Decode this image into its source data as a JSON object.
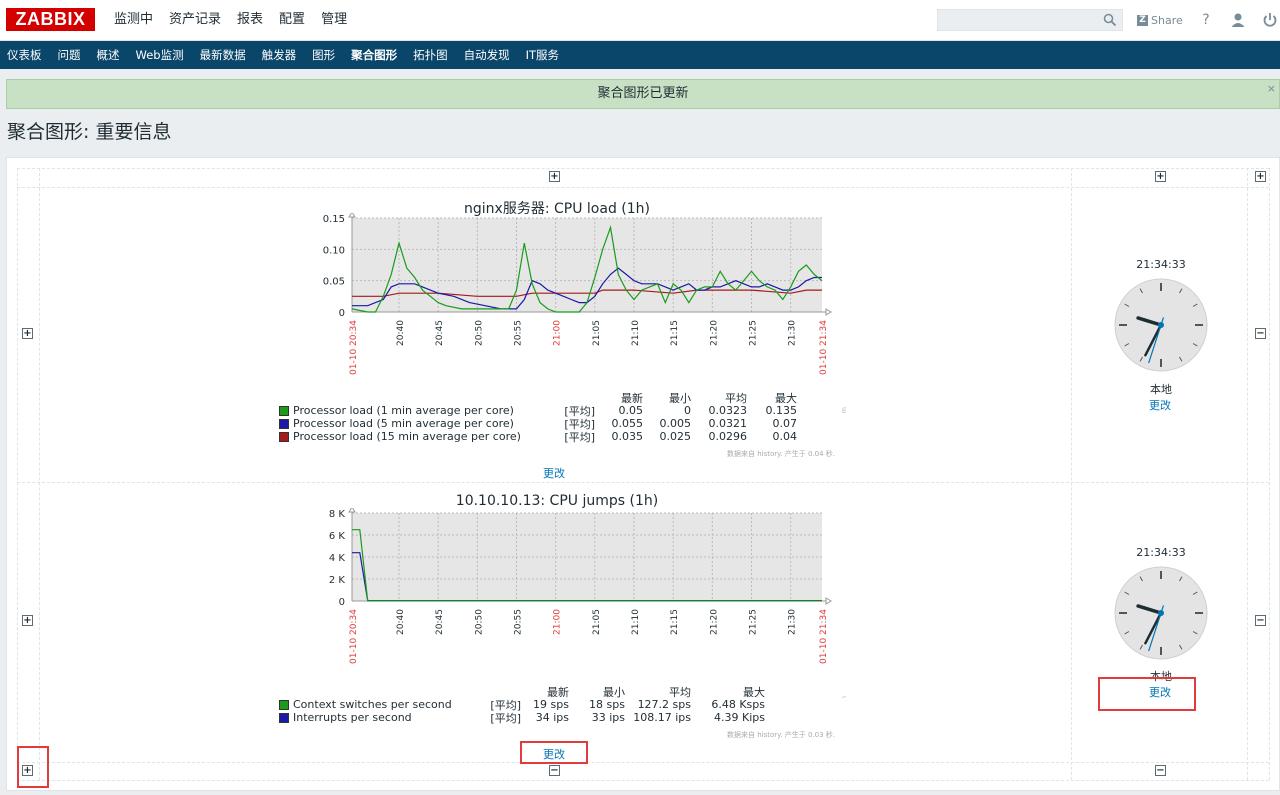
{
  "header": {
    "logo": "ZABBIX",
    "menu": [
      "监测中",
      "资产记录",
      "报表",
      "配置",
      "管理"
    ],
    "search": {
      "placeholder": "",
      "value": ""
    },
    "share_label": "Share",
    "help_label": "?"
  },
  "subnav": {
    "items": [
      "仪表板",
      "问题",
      "概述",
      "Web监测",
      "最新数据",
      "触发器",
      "图形",
      "聚合图形",
      "拓扑图",
      "自动发现",
      "IT服务"
    ],
    "active": "聚合图形"
  },
  "message": {
    "text": "聚合图形已更新",
    "close": "×"
  },
  "page": {
    "title": "聚合图形: 重要信息"
  },
  "controls": {
    "plus": "+",
    "minus": "−"
  },
  "graph1": {
    "title": "nginx服务器: CPU load (1h)",
    "y_ticks": [
      "0.15",
      "0.10",
      "0.05",
      "0"
    ],
    "x_ticks": [
      "20:40",
      "20:45",
      "20:50",
      "20:55",
      "21:00",
      "21:05",
      "21:10",
      "21:15",
      "21:20",
      "21:25",
      "21:30"
    ],
    "x_start": "01-10 20:34",
    "x_end": "01-10 21:34",
    "watermark": "http://www.zabbix.com",
    "legend_headers": [
      "最新",
      "最小",
      "平均",
      "最大"
    ],
    "legend": [
      {
        "name": "Processor load (1 min average per core)",
        "func": "[平均]",
        "last": "0.05",
        "min": "0",
        "avg": "0.0323",
        "max": "0.135",
        "color": "#1a9b1a"
      },
      {
        "name": "Processor load (5 min average per core)",
        "func": "[平均]",
        "last": "0.055",
        "min": "0.005",
        "avg": "0.0321",
        "max": "0.07",
        "color": "#1a1aa6"
      },
      {
        "name": "Processor load (15 min average per core)",
        "func": "[平均]",
        "last": "0.035",
        "min": "0.025",
        "avg": "0.0296",
        "max": "0.04",
        "color": "#a61a1a"
      }
    ],
    "footnote": "数据来自 history. 产生于 0.04 秒.",
    "edit_label": "更改"
  },
  "graph2": {
    "title": "10.10.10.13: CPU jumps (1h)",
    "y_ticks": [
      "8 K",
      "6 K",
      "4 K",
      "2 K",
      "0"
    ],
    "x_ticks": [
      "20:40",
      "20:45",
      "20:50",
      "20:55",
      "21:00",
      "21:05",
      "21:10",
      "21:15",
      "21:20",
      "21:25",
      "21:30"
    ],
    "x_start": "01-10 20:34",
    "x_end": "01-10 21:34",
    "watermark": "http://www.zabbix.com",
    "legend_headers": [
      "最新",
      "最小",
      "平均",
      "最大"
    ],
    "legend": [
      {
        "name": "Context switches per second",
        "func": "[平均]",
        "last": "19 sps",
        "min": "18 sps",
        "avg": "127.2 sps",
        "max": "6.48 Ksps",
        "color": "#1a9b1a"
      },
      {
        "name": "Interrupts per second",
        "func": "[平均]",
        "last": "34 ips",
        "min": "33 ips",
        "avg": "108.17 ips",
        "max": "4.39 Kips",
        "color": "#1a1aa6"
      }
    ],
    "footnote": "数据来自 history. 产生于 0.03 秒.",
    "edit_label": "更改"
  },
  "clock1": {
    "time": "21:34:33",
    "label": "本地",
    "edit_label": "更改"
  },
  "clock2": {
    "time": "21:34:33",
    "label": "本地",
    "edit_label": "更改"
  },
  "chart_data": [
    {
      "type": "line",
      "title": "nginx服务器: CPU load (1h)",
      "x_range": [
        "01-10 20:34",
        "01-10 21:34"
      ],
      "ylim": [
        0,
        0.15
      ],
      "grid": true,
      "series": [
        {
          "name": "Processor load (1 min average per core)",
          "color": "#1a9b1a",
          "x": [
            "20:34",
            "20:36",
            "20:37",
            "20:38",
            "20:39",
            "20:40",
            "20:41",
            "20:42",
            "20:43",
            "20:44",
            "20:45",
            "20:46",
            "20:48",
            "20:50",
            "20:52",
            "20:54",
            "20:55",
            "20:56",
            "20:57",
            "20:58",
            "20:59",
            "21:00",
            "21:01",
            "21:02",
            "21:03",
            "21:04",
            "21:05",
            "21:06",
            "21:07",
            "21:08",
            "21:09",
            "21:10",
            "21:11",
            "21:12",
            "21:13",
            "21:14",
            "21:15",
            "21:16",
            "21:17",
            "21:18",
            "21:19",
            "21:20",
            "21:21",
            "21:22",
            "21:23",
            "21:24",
            "21:25",
            "21:26",
            "21:27",
            "21:28",
            "21:29",
            "21:30",
            "21:31",
            "21:32",
            "21:33",
            "21:34"
          ],
          "y": [
            0.005,
            0.0,
            0.0,
            0.025,
            0.06,
            0.11,
            0.07,
            0.055,
            0.035,
            0.025,
            0.015,
            0.01,
            0.005,
            0.005,
            0.005,
            0.005,
            0.035,
            0.11,
            0.045,
            0.015,
            0.005,
            0.0,
            0.0,
            0.0,
            0.0,
            0.015,
            0.055,
            0.1,
            0.135,
            0.06,
            0.035,
            0.02,
            0.035,
            0.04,
            0.045,
            0.015,
            0.045,
            0.035,
            0.015,
            0.035,
            0.04,
            0.04,
            0.065,
            0.045,
            0.035,
            0.05,
            0.065,
            0.05,
            0.04,
            0.035,
            0.02,
            0.04,
            0.065,
            0.075,
            0.06,
            0.05
          ]
        },
        {
          "name": "Processor load (5 min average per core)",
          "color": "#1a1aa6",
          "x": [
            "20:34",
            "20:36",
            "20:37",
            "20:38",
            "20:39",
            "20:40",
            "20:41",
            "20:42",
            "20:43",
            "20:44",
            "20:45",
            "20:47",
            "20:49",
            "20:51",
            "20:53",
            "20:55",
            "20:56",
            "20:57",
            "20:58",
            "20:59",
            "21:00",
            "21:01",
            "21:02",
            "21:03",
            "21:04",
            "21:05",
            "21:06",
            "21:07",
            "21:08",
            "21:09",
            "21:10",
            "21:11",
            "21:12",
            "21:13",
            "21:14",
            "21:15",
            "21:16",
            "21:17",
            "21:18",
            "21:19",
            "21:20",
            "21:21",
            "21:22",
            "21:23",
            "21:24",
            "21:25",
            "21:26",
            "21:27",
            "21:28",
            "21:29",
            "21:30",
            "21:31",
            "21:32",
            "21:33",
            "21:34"
          ],
          "y": [
            0.01,
            0.01,
            0.015,
            0.02,
            0.04,
            0.045,
            0.045,
            0.045,
            0.04,
            0.035,
            0.03,
            0.025,
            0.015,
            0.01,
            0.005,
            0.005,
            0.02,
            0.05,
            0.045,
            0.035,
            0.03,
            0.025,
            0.02,
            0.015,
            0.015,
            0.025,
            0.045,
            0.06,
            0.07,
            0.06,
            0.05,
            0.045,
            0.045,
            0.045,
            0.04,
            0.035,
            0.04,
            0.045,
            0.035,
            0.035,
            0.04,
            0.04,
            0.045,
            0.05,
            0.045,
            0.04,
            0.04,
            0.045,
            0.04,
            0.035,
            0.035,
            0.04,
            0.05,
            0.055,
            0.055
          ]
        },
        {
          "name": "Processor load (15 min average per core)",
          "color": "#a61a1a",
          "x": [
            "20:34",
            "20:38",
            "20:40",
            "20:45",
            "20:50",
            "20:55",
            "20:57",
            "21:00",
            "21:05",
            "21:06",
            "21:10",
            "21:15",
            "21:18",
            "21:20",
            "21:25",
            "21:30",
            "21:32",
            "21:34"
          ],
          "y": [
            0.025,
            0.025,
            0.03,
            0.03,
            0.025,
            0.025,
            0.03,
            0.03,
            0.03,
            0.035,
            0.035,
            0.03,
            0.035,
            0.035,
            0.035,
            0.03,
            0.035,
            0.035
          ]
        }
      ]
    },
    {
      "type": "line",
      "title": "10.10.10.13: CPU jumps (1h)",
      "x_range": [
        "01-10 20:34",
        "01-10 21:34"
      ],
      "ylim": [
        0,
        8000
      ],
      "grid": true,
      "series": [
        {
          "name": "Context switches per second",
          "color": "#1a9b1a",
          "x": [
            "20:34",
            "20:35",
            "20:36",
            "21:34"
          ],
          "y": [
            6480,
            6480,
            19,
            19
          ]
        },
        {
          "name": "Interrupts per second",
          "color": "#1a1aa6",
          "x": [
            "20:34",
            "20:35",
            "20:36",
            "21:34"
          ],
          "y": [
            4390,
            4390,
            34,
            34
          ]
        }
      ]
    }
  ]
}
